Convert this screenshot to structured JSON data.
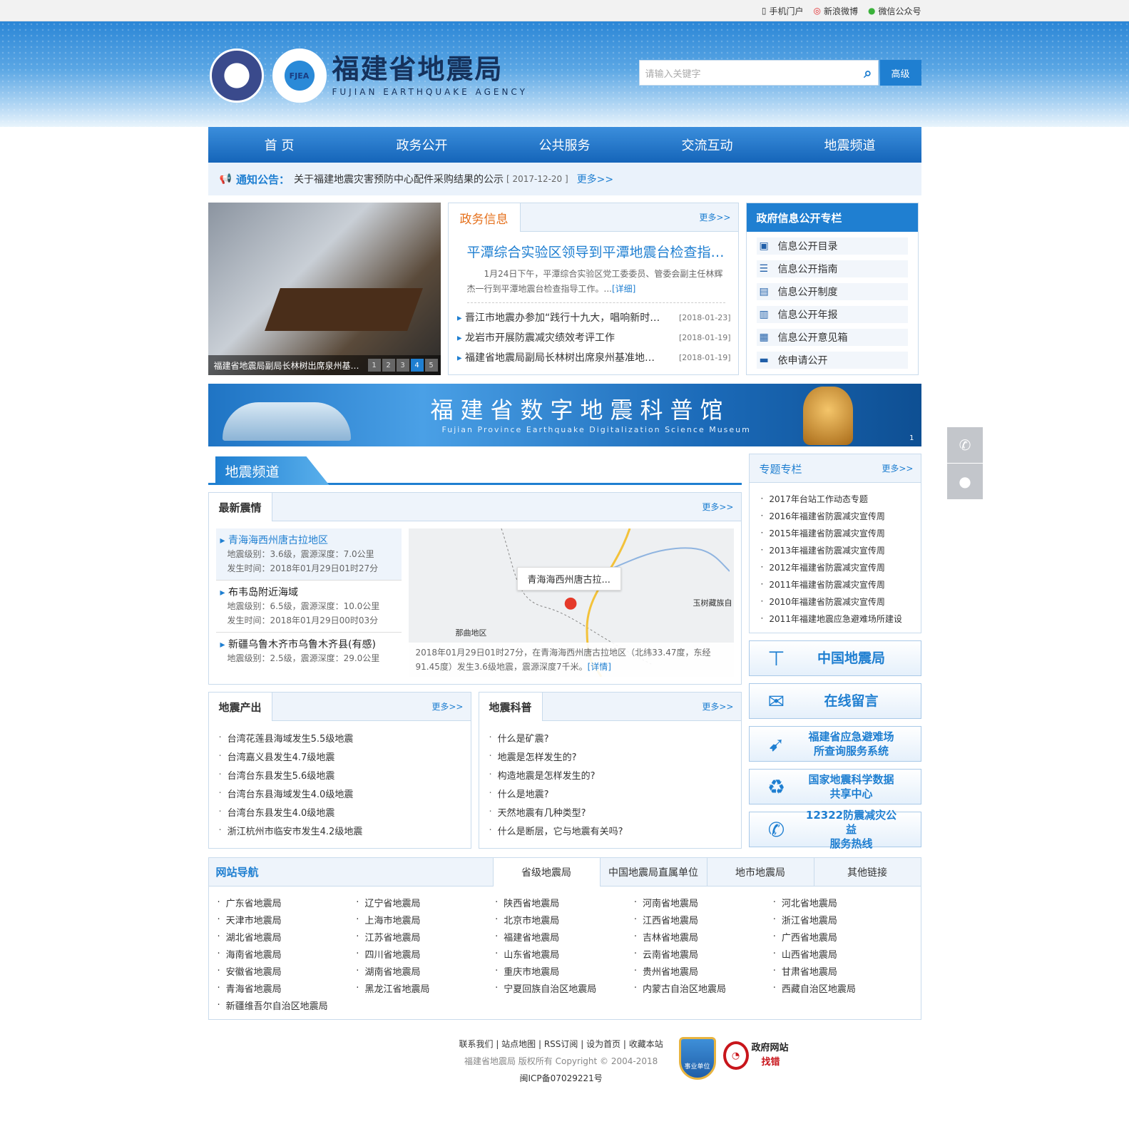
{
  "topbar": {
    "mobile": "手机门户",
    "weibo": "新浪微博",
    "wechat": "微信公众号"
  },
  "header": {
    "logo2_text": "FJEA",
    "title": "福建省地震局",
    "subtitle": "FUJIAN EARTHQUAKE AGENCY"
  },
  "search": {
    "placeholder": "请输入关键字",
    "advanced": "高级"
  },
  "nav": [
    "首 页",
    "政务公开",
    "公共服务",
    "交流互动",
    "地震频道"
  ],
  "notice": {
    "label": "通知公告：",
    "text": "关于福建地震灾害预防中心配件采购结果的公示",
    "date": "[ 2017-12-20 ]",
    "more": "更多>>"
  },
  "slide": {
    "caption": "福建省地震局副局长林树出席泉州基准地震台…",
    "dots": [
      "1",
      "2",
      "3",
      "4",
      "5"
    ],
    "active": 4
  },
  "gov": {
    "title": "政务信息",
    "more": "更多>>",
    "headline": "平潭综合实验区领导到平潭地震台检查指导工作",
    "summary": "1月24日下午，平潭综合实验区党工委委员、管委会副主任林辉杰一行到平潭地震台检查指导工作。...",
    "detail": "[详细]",
    "items": [
      {
        "t": "晋江市地震办参加“践行十九大，唱响新时代”活动",
        "d": "[2018-01-23]"
      },
      {
        "t": "龙岩市开展防震减灾绩效考评工作",
        "d": "[2018-01-19]"
      },
      {
        "t": "福建省地震局副局长林树出席泉州基准地震台揭牌仪式",
        "d": "[2018-01-19]"
      }
    ]
  },
  "info": {
    "title": "政府信息公开专栏",
    "items": [
      "信息公开目录",
      "信息公开指南",
      "信息公开制度",
      "信息公开年报",
      "信息公开意见箱",
      "依申请公开"
    ]
  },
  "banner": {
    "title": "福建省数字地震科普馆",
    "subtitle": "Fujian Province Earthquake Digitalization Science Museum",
    "page": "1"
  },
  "channel": {
    "title": "地震频道"
  },
  "quake": {
    "title": "最新震情",
    "more": "更多>>",
    "items": [
      {
        "t": "青海海西州唐古拉地区",
        "l": "地震级别：3.6级，震源深度：7.0公里",
        "time": "发生时间：2018年01月29日01时27分"
      },
      {
        "t": "布韦岛附近海域",
        "l": "地震级别：6.5级，震源深度：10.0公里",
        "time": "发生时间：2018年01月29日00时03分"
      },
      {
        "t": "新疆乌鲁木齐市乌鲁木齐县(有感)",
        "l": "地震级别：2.5级，震源深度：29.0公里",
        "time": ""
      }
    ],
    "map_bubble": "青海海西州唐古拉...",
    "map_label1": "玉树藏族自",
    "map_label2": "那曲地区",
    "map_desc": "2018年01月29日01时27分，在青海海西州唐古拉地区（北纬33.47度，东经91.45度）发生3.6级地震，震源深度7千米。",
    "map_detail": "[详情]"
  },
  "output": {
    "title": "地震产出",
    "more": "更多>>",
    "items": [
      "台湾花莲县海域发生5.5级地震",
      "台湾嘉义县发生4.7级地震",
      "台湾台东县发生5.6级地震",
      "台湾台东县海域发生4.0级地震",
      "台湾台东县发生4.0级地震",
      "浙江杭州市临安市发生4.2级地震"
    ]
  },
  "science": {
    "title": "地震科普",
    "more": "更多>>",
    "items": [
      "什么是矿震?",
      "地震是怎样发生的?",
      "构造地震是怎样发生的?",
      "什么是地震?",
      "天然地震有几种类型?",
      "什么是断层，它与地震有关吗?"
    ]
  },
  "topic": {
    "title": "专题专栏",
    "more": "更多>>",
    "items": [
      "2017年台站工作动态专题",
      "2016年福建省防震减灾宣传周",
      "2015年福建省防震减灾宣传周",
      "2013年福建省防震减灾宣传周",
      "2012年福建省防震减灾宣传周",
      "2011年福建省防震减灾宣传周",
      "2010年福建省防震减灾宣传周",
      "2011年福建地震应急避难场所建设"
    ]
  },
  "quicklinks": [
    {
      "icon": "signpost-icon",
      "t1": "中国地震局",
      "t2": ""
    },
    {
      "icon": "mail-icon",
      "t1": "在线留言",
      "t2": ""
    },
    {
      "icon": "running-icon",
      "t1": "福建省应急避难场",
      "t2": "所查询服务系统"
    },
    {
      "icon": "recycle-icon",
      "t1": "国家地震科学数据",
      "t2": "共享中心"
    },
    {
      "icon": "phone-icon",
      "t1": "12322防震减灾公益",
      "t2": "服务热线"
    }
  ],
  "sitenav": {
    "title": "网站导航",
    "tabs": [
      "省级地震局",
      "中国地震局直属单位",
      "地市地震局",
      "其他链接"
    ],
    "items": [
      "广东省地震局",
      "辽宁省地震局",
      "陕西省地震局",
      "河南省地震局",
      "河北省地震局",
      "天津市地震局",
      "上海市地震局",
      "北京市地震局",
      "江西省地震局",
      "浙江省地震局",
      "湖北省地震局",
      "江苏省地震局",
      "福建省地震局",
      "吉林省地震局",
      "广西省地震局",
      "海南省地震局",
      "四川省地震局",
      "山东省地震局",
      "云南省地震局",
      "山西省地震局",
      "安徽省地震局",
      "湖南省地震局",
      "重庆市地震局",
      "贵州省地震局",
      "甘肃省地震局",
      "青海省地震局",
      "黑龙江省地震局",
      "宁夏回族自治区地震局",
      "内蒙古自治区地震局",
      "西藏自治区地震局",
      "新疆维吾尔自治区地震局"
    ]
  },
  "footer": {
    "links": "联系我们 | 站点地图 | RSS订阅 | 设为首页 | 收藏本站",
    "copyright": "福建省地震局  版权所有  Copyright © 2004-2018",
    "icp": "闽ICP备07029221号",
    "badge1": "事业单位",
    "badge2_top": "政府网站",
    "badge2_bottom": "找错"
  }
}
